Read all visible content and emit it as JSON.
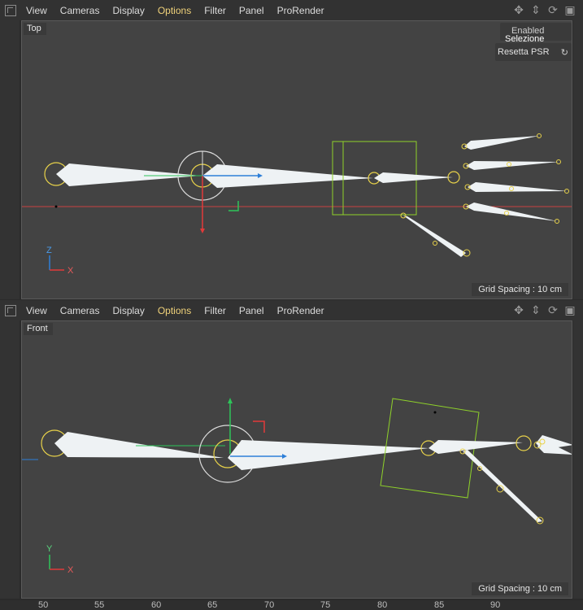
{
  "top_view": {
    "menu": [
      "View",
      "Cameras",
      "Display",
      "Options",
      "Filter",
      "Panel",
      "ProRender"
    ],
    "active_menu": "Options",
    "label": "Top",
    "grid_spacing": "Grid Spacing : 10 cm",
    "axes": {
      "vertical": "Z",
      "horizontal": "X"
    },
    "overlay": {
      "enabled": "Enabled",
      "selection": "Selezione",
      "reset": "Resetta PSR"
    }
  },
  "front_view": {
    "menu": [
      "View",
      "Cameras",
      "Display",
      "Options",
      "Filter",
      "Panel",
      "ProRender"
    ],
    "active_menu": "Options",
    "label": "Front",
    "grid_spacing": "Grid Spacing : 10 cm",
    "axes": {
      "vertical": "Y",
      "horizontal": "X"
    }
  },
  "timeline_ruler": [
    "50",
    "55",
    "60",
    "65",
    "70",
    "75",
    "80",
    "85",
    "90"
  ],
  "colors": {
    "viewport_bg": "#434343",
    "active_menu": "#f0d27a",
    "bone_fill": "#eef2f4",
    "joint_ring": "#e8d24a",
    "selection_box": "#8fd22a",
    "x_axis": "#e23a3a",
    "y_axis": "#2ec45a",
    "z_axis": "#2e7fd8"
  }
}
